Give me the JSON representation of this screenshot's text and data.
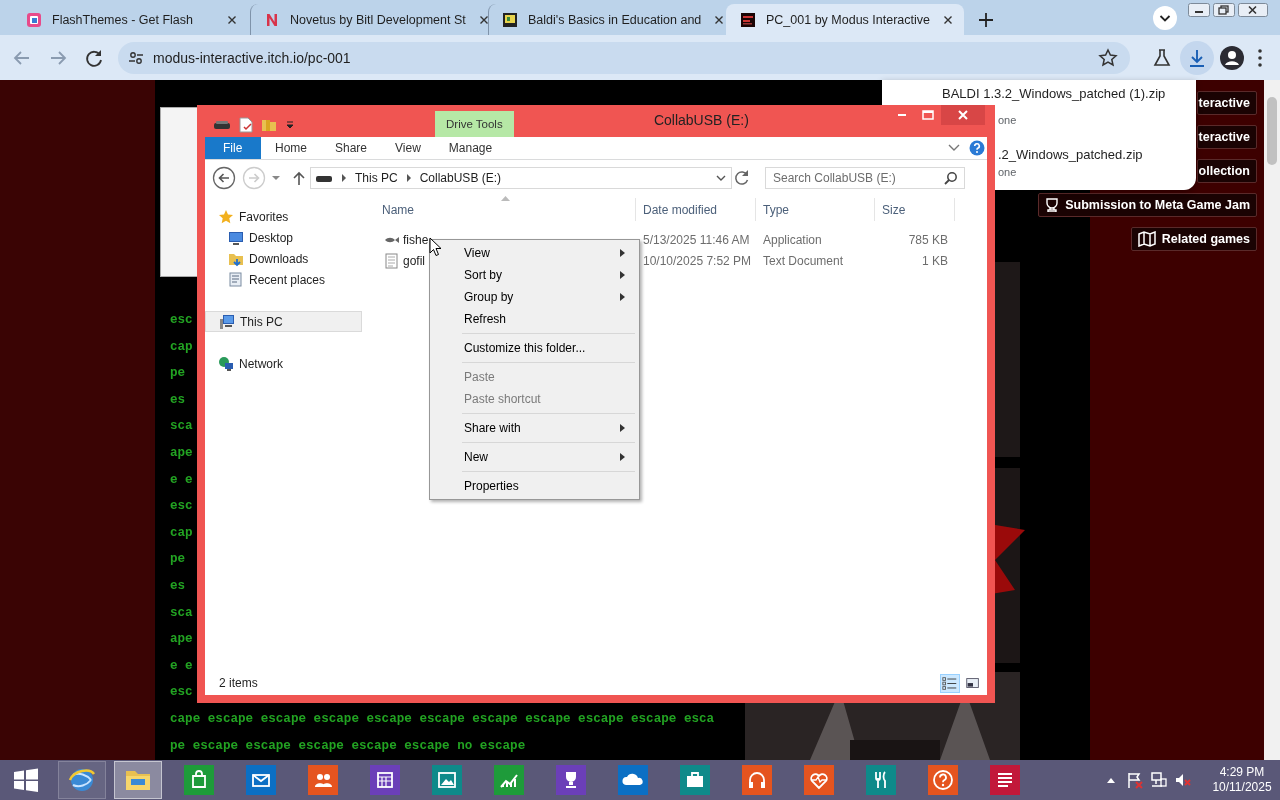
{
  "browser": {
    "tabs": [
      {
        "title": "FlashThemes - Get Flash",
        "selected": false
      },
      {
        "title": "Novetus by Bitl Development St",
        "selected": false
      },
      {
        "title": "Baldi's Basics in Education and",
        "selected": false
      },
      {
        "title": "PC_001 by Modus Interactive",
        "selected": true
      }
    ],
    "address": "modus-interactive.itch.io/pc-001"
  },
  "downloads": [
    {
      "name": "BALDI 1.3.2_Windows_patched (1).zip",
      "status": "one"
    },
    {
      "name": ".2_Windows_patched.zip",
      "status": "one"
    }
  ],
  "page": {
    "console_lines": [
      "esc",
      "cap",
      "pe",
      "es",
      "sca",
      "ape",
      "e e",
      "esc",
      "cap",
      "pe",
      "es",
      "sca",
      "ape",
      "e e",
      "esc",
      "cape escape escape escape escape escape escape escape escape escape esca",
      "pe escape escape escape escape escape no escape"
    ],
    "side_buttons": [
      {
        "kind": "plain",
        "label": "teractive"
      },
      {
        "kind": "plain",
        "label": "teractive"
      },
      {
        "kind": "plain",
        "label": "ollection"
      },
      {
        "kind": "jam",
        "label": "Submission to Meta Game Jam"
      },
      {
        "kind": "related",
        "label": "Related games"
      }
    ]
  },
  "explorer": {
    "title": "CollabUSB (E:)",
    "context_tab": "Drive Tools",
    "ribbon_tabs": [
      {
        "kind": "file",
        "label": "File"
      },
      {
        "kind": "tab",
        "label": "Home"
      },
      {
        "kind": "tab",
        "label": "Share"
      },
      {
        "kind": "tab",
        "label": "View"
      },
      {
        "kind": "tab",
        "label": "Manage"
      }
    ],
    "breadcrumb": [
      "This PC",
      "CollabUSB (E:)"
    ],
    "search": {
      "placeholder": "Search CollabUSB (E:)"
    },
    "nav": [
      {
        "kind": "group",
        "label": "Favorites",
        "selected": false
      },
      {
        "kind": "item",
        "label": "Desktop",
        "selected": false
      },
      {
        "kind": "item",
        "label": "Downloads",
        "selected": false
      },
      {
        "kind": "item",
        "label": "Recent places",
        "selected": false
      },
      {
        "kind": "group",
        "label": "This PC",
        "selected": true
      },
      {
        "kind": "group",
        "label": "Network",
        "selected": false
      }
    ],
    "columns": [
      "Name",
      "Date modified",
      "Type",
      "Size"
    ],
    "files": [
      {
        "name": "fishe",
        "date": "5/13/2025 11:46 AM",
        "type": "Application",
        "size": "785 KB"
      },
      {
        "name": "gofil",
        "date": "10/10/2025 7:52 PM",
        "type": "Text Document",
        "size": "1 KB"
      }
    ],
    "status": "2 items",
    "view_modes": [
      {
        "selected": true
      },
      {
        "selected": false
      }
    ]
  },
  "context_menu": [
    {
      "kind": "item",
      "label": "View",
      "submenu": true,
      "disabled": false
    },
    {
      "kind": "item",
      "label": "Sort by",
      "submenu": true,
      "disabled": false
    },
    {
      "kind": "item",
      "label": "Group by",
      "submenu": true,
      "disabled": false
    },
    {
      "kind": "item",
      "label": "Refresh",
      "submenu": false,
      "disabled": false
    },
    {
      "kind": "separator"
    },
    {
      "kind": "item",
      "label": "Customize this folder...",
      "submenu": false,
      "disabled": false
    },
    {
      "kind": "separator"
    },
    {
      "kind": "item",
      "label": "Paste",
      "submenu": false,
      "disabled": true
    },
    {
      "kind": "item",
      "label": "Paste shortcut",
      "submenu": false,
      "disabled": true
    },
    {
      "kind": "separator"
    },
    {
      "kind": "item",
      "label": "Share with",
      "submenu": true,
      "disabled": false
    },
    {
      "kind": "separator"
    },
    {
      "kind": "item",
      "label": "New",
      "submenu": true,
      "disabled": false
    },
    {
      "kind": "separator"
    },
    {
      "kind": "item",
      "label": "Properties",
      "submenu": false,
      "disabled": false
    }
  ],
  "taskbar": {
    "windows": [
      {
        "active": false
      },
      {
        "active": true
      }
    ],
    "tiles": [
      {
        "color": "#1e9b3a"
      },
      {
        "color": "#0b6fc4"
      },
      {
        "color": "#e5541f"
      },
      {
        "color": "#6b3fb8"
      },
      {
        "color": "#0e8a8a"
      },
      {
        "color": "#1e9b3a"
      },
      {
        "color": "#6b3fb8"
      },
      {
        "color": "#0b6fc4"
      },
      {
        "color": "#0e8a8a"
      },
      {
        "color": "#e5541f"
      },
      {
        "color": "#e5541f"
      },
      {
        "color": "#0e8a8a"
      },
      {
        "color": "#e5541f"
      },
      {
        "color": "#c2183a"
      }
    ],
    "clock": {
      "time": "4:29 PM",
      "date": "10/11/2025"
    }
  }
}
